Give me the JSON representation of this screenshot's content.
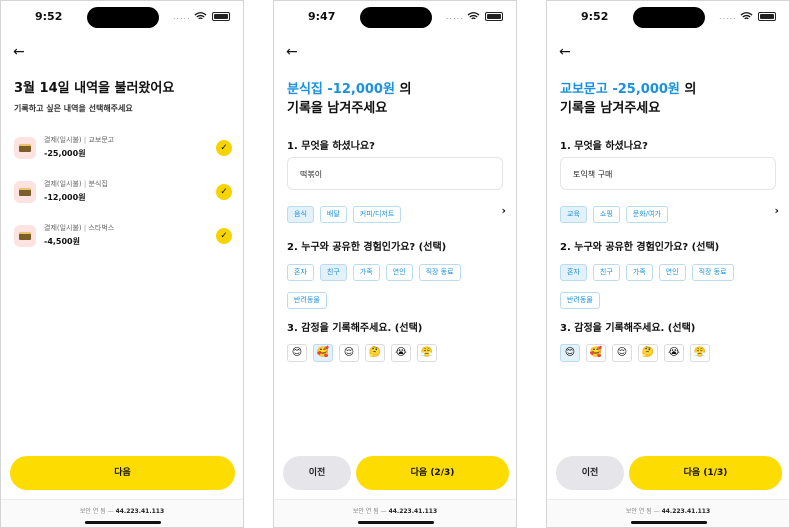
{
  "status": {
    "time1": "9:52",
    "time2": "9:47",
    "time3": "9:52",
    "dots": "....."
  },
  "screen1": {
    "title": "3월 14일 내역을 불러왔어요",
    "subtitle": "기록하고 싶은 내역을 선택해주세요",
    "records": [
      {
        "cat": "결제(일시불)",
        "sep": " | ",
        "merchant": "교보문고",
        "amount": "-25,000원"
      },
      {
        "cat": "결제(일시불)",
        "sep": " | ",
        "merchant": "분식집",
        "amount": "-12,000원"
      },
      {
        "cat": "결제(일시불)",
        "sep": " | ",
        "merchant": "스타벅스",
        "amount": "-4,500원"
      }
    ],
    "next_label": "다음",
    "check": "✓"
  },
  "screen2": {
    "title_hl": "분식집 -12,000원",
    "title_rest": " 의",
    "title_line2": "기록을 남겨주세요",
    "q1": "1. 무엇을 하셨나요?",
    "input_value": "떡볶이",
    "categories": [
      "음식",
      "배달",
      "커피/디저트"
    ],
    "q2": "2. 누구와 공유한 경험인가요? (선택)",
    "people": [
      "혼자",
      "친구",
      "가족",
      "연인",
      "직장 동료",
      "반려동물"
    ],
    "q3": "3. 감정을 기록해주세요. (선택)",
    "emotions": [
      "😊",
      "🥰",
      "😌",
      "🤔",
      "😭",
      "😤"
    ],
    "prev_label": "이전",
    "next_label": "다음 (2/3)"
  },
  "screen3": {
    "title_hl": "교보문고 -25,000원",
    "title_rest": " 의",
    "title_line2": "기록을 남겨주세요",
    "q1": "1. 무엇을 하셨나요?",
    "input_value": "토익책 구매",
    "categories": [
      "교육",
      "쇼핑",
      "문화/여가"
    ],
    "q2": "2. 누구와 공유한 경험인가요? (선택)",
    "people": [
      "혼자",
      "친구",
      "가족",
      "연인",
      "직장 동료",
      "반려동물"
    ],
    "q3": "3. 감정을 기록해주세요. (선택)",
    "emotions": [
      "😊",
      "🥰",
      "😌",
      "🤔",
      "😭",
      "😤"
    ],
    "prev_label": "이전",
    "next_label": "다음 (1/3)"
  },
  "footer": {
    "label": "보안 연 됨 — ",
    "ip": "44.223.41.113"
  },
  "icons": {
    "back": "←",
    "chevron": "›"
  },
  "colors": {
    "accent": "#1a91e0",
    "primary": "#fddc02"
  }
}
